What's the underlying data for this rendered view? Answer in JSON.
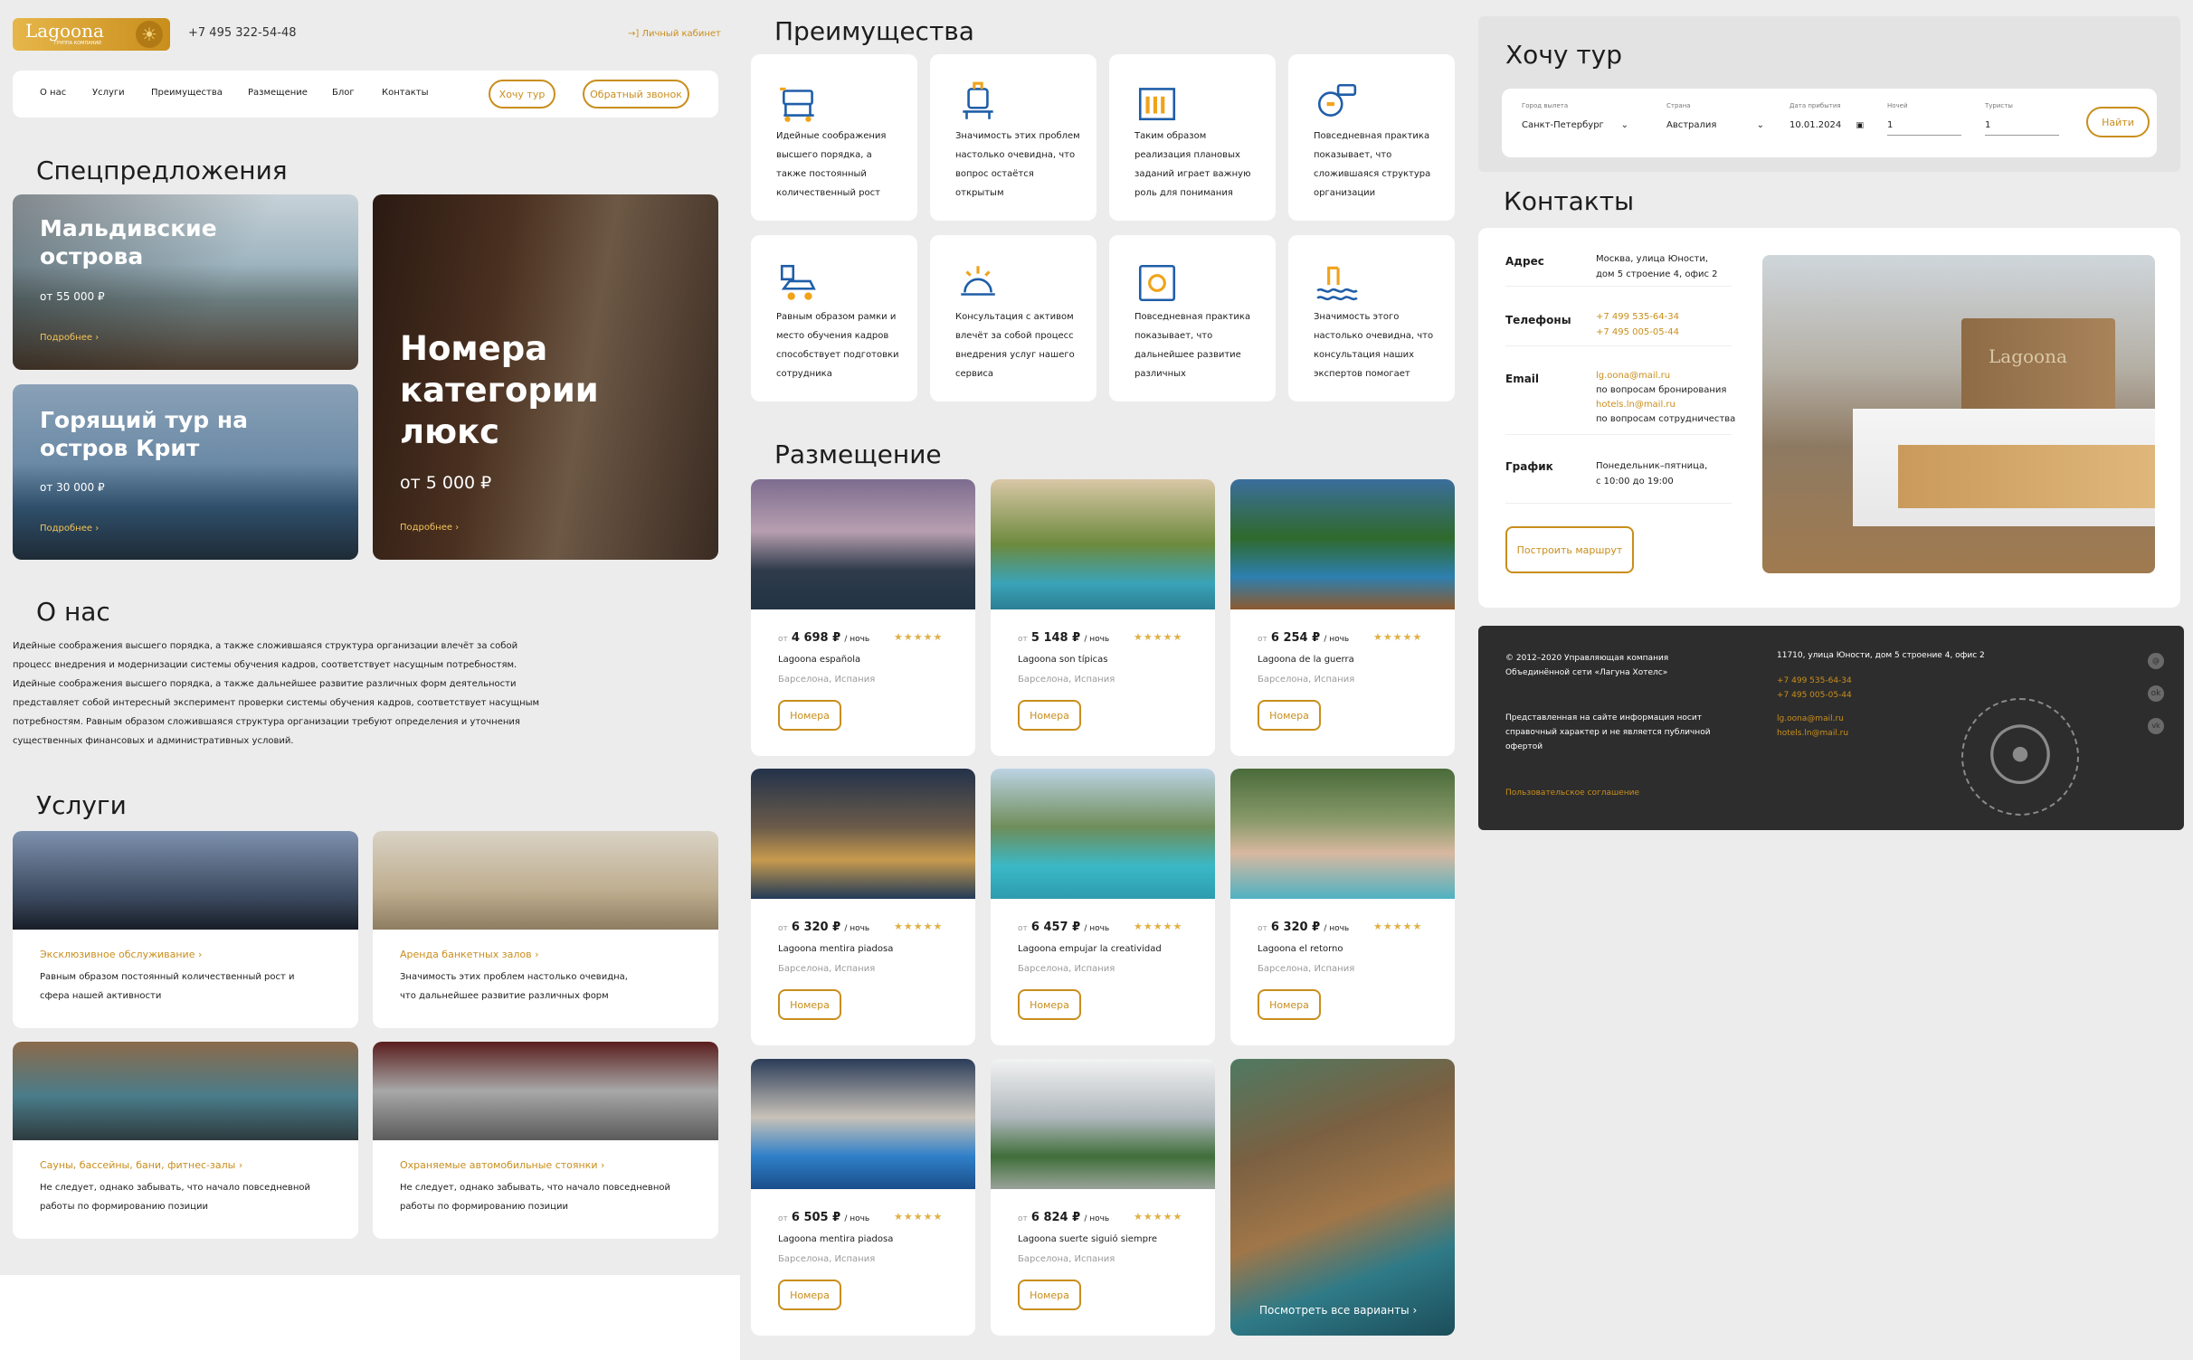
{
  "header": {
    "logo": "Lagoona",
    "logo_sub": "ГРУППА КОМПАНИЙ",
    "phone": "+7 495 322-54-48",
    "cabinet": "Личный кабинет"
  },
  "nav": {
    "items": [
      "О нас",
      "Услуги",
      "Преимущества",
      "Размещение",
      "Блог",
      "Контакты"
    ],
    "want_tour": "Хочу тур",
    "callback": "Обратный звонок"
  },
  "offers": {
    "title": "Спецпредложения",
    "more": "Подробнее",
    "maldives": {
      "title": "Мальдивские острова",
      "price": "от 55 000 ₽"
    },
    "crete": {
      "title": "Горящий тур на остров Крит",
      "price": "от 30 000 ₽"
    },
    "lux": {
      "title": "Номера категории люкс",
      "price": "от 5 000 ₽"
    }
  },
  "about": {
    "title": "О нас",
    "text": "Идейные соображения высшего порядка, а также сложившаяся структура организации влечёт за собой процесс внедрения и модернизации системы обучения кадров, соответствует насущным потребностям. Идейные соображения высшего порядка, а также дальнейшее развитие различных форм деятельности представляет собой интересный эксперимент проверки системы обучения кадров, соответствует насущным потребностям. Равным образом сложившаяся структура организации требуют определения и уточнения существенных финансовых и административных условий."
  },
  "services": {
    "title": "Услуги",
    "items": [
      {
        "name": "Эксклюзивное обслуживание",
        "desc": "Равным образом постоянный количественный рост и сфера нашей активности"
      },
      {
        "name": "Аренда банкетных залов",
        "desc": "Значимость этих проблем настолько очевидна, что дальнейшее развитие различных форм"
      },
      {
        "name": "Сауны, бассейны, бани, фитнес-залы",
        "desc": "Не следует, однако забывать, что начало повседневной работы по формированию позиции"
      },
      {
        "name": "Охраняемые автомобильные стоянки",
        "desc": "Не следует, однако забывать, что начало повседневной работы по формированию позиции"
      }
    ]
  },
  "advantages": {
    "title": "Преимущества",
    "items": [
      {
        "icon": "hotel-cart-icon",
        "text": "Идейные соображения высшего порядка, а также постоянный количественный рост"
      },
      {
        "icon": "luggage-cart-icon",
        "text": "Значимость этих проблем настолько очевидна, что вопрос остаётся открытым"
      },
      {
        "icon": "building-icon",
        "text": "Таким образом реализация плановых заданий играет важную роль для понимания"
      },
      {
        "icon": "dryer-icon",
        "text": "Повседневная практика показывает, что сложившаяся структура организации"
      },
      {
        "icon": "parking-icon",
        "text": "Равным образом рамки и место обучения кадров способствует подготовки сотрудника"
      },
      {
        "icon": "reception-bell-icon",
        "text": "Консультация с активом влечёт за собой процесс внедрения услуг нашего сервиса"
      },
      {
        "icon": "safe-icon",
        "text": "Повседневная практика показывает, что дальнейшее развитие различных"
      },
      {
        "icon": "pool-icon",
        "text": "Значимость этого настолько очевидна, что консультация наших экспертов помогает"
      }
    ]
  },
  "accommodation": {
    "title": "Размещение",
    "from": "от",
    "per_night": "/ ночь",
    "button": "Номера",
    "view_all": "Посмотреть все варианты",
    "hotels": [
      {
        "price": "4 698 ₽",
        "stars": "★★★★★",
        "name": "Lagoona española",
        "loc": "Барселона, Испания"
      },
      {
        "price": "5 148 ₽",
        "stars": "★★★★★",
        "name": "Lagoona son típicas",
        "loc": "Барселона, Испания"
      },
      {
        "price": "6 254 ₽",
        "stars": "★★★★★",
        "name": "Lagoona de la guerra",
        "loc": "Барселона, Испания"
      },
      {
        "price": "6 320 ₽",
        "stars": "★★★★★",
        "name": "Lagoona mentira piadosa",
        "loc": "Барселона, Испания"
      },
      {
        "price": "6 457 ₽",
        "stars": "★★★★★",
        "name": "Lagoona empujar la creatividad",
        "loc": "Барселона, Испания"
      },
      {
        "price": "6 320 ₽",
        "stars": "★★★★★",
        "name": "Lagoona el retorno",
        "loc": "Барселона, Испания"
      },
      {
        "price": "6 505 ₽",
        "stars": "★★★★★",
        "name": "Lagoona mentira piadosa",
        "loc": "Барселона, Испания"
      },
      {
        "price": "6 824 ₽",
        "stars": "★★★★★",
        "name": "Lagoona suerte siguió siempre",
        "loc": "Барселона, Испания"
      }
    ]
  },
  "tour": {
    "title": "Хочу тур",
    "city_label": "Город вылета",
    "city": "Санкт-Петербург",
    "country_label": "Страна",
    "country": "Австралия",
    "date_label": "Дата прибытия",
    "date": "10.01.2024",
    "nights_label": "Ночей",
    "nights": "1",
    "tourists_label": "Туристы",
    "tourists": "1",
    "find": "Найти"
  },
  "contacts": {
    "title": "Контакты",
    "address_label": "Адрес",
    "address": "Москва, улица Юности, дом 5 строение 4, офис 2",
    "phones_label": "Телефоны",
    "phone1": "+7 499 535-64-34",
    "phone2": "+7 495 005-05-44",
    "email_label": "Email",
    "email1": "lg.oona@mail.ru",
    "email1_note": "по вопросам бронирования",
    "email2": "hotels.ln@mail.ru",
    "email2_note": "по вопросам сотрудничества",
    "schedule_label": "График",
    "schedule": "Понедельник–пятница, с 10:00 до 19:00",
    "route": "Построить маршрут",
    "sign": "Lagoona"
  },
  "footer": {
    "copyright": "© 2012–2020 Управляющая компания Объединённой сети «Лагуна Хотелс»",
    "disclaimer": "Представленная на сайте информация носит справочный характер и не является публичной офертой",
    "agreement": "Пользовательское соглашение",
    "address": "11710, улица Юности, дом 5 строение 4, офис 2",
    "phone1": "+7 499 535-64-34",
    "phone2": "+7 495 005-05-44",
    "email1": "lg.oona@mail.ru",
    "email2": "hotels.ln@mail.ru"
  }
}
